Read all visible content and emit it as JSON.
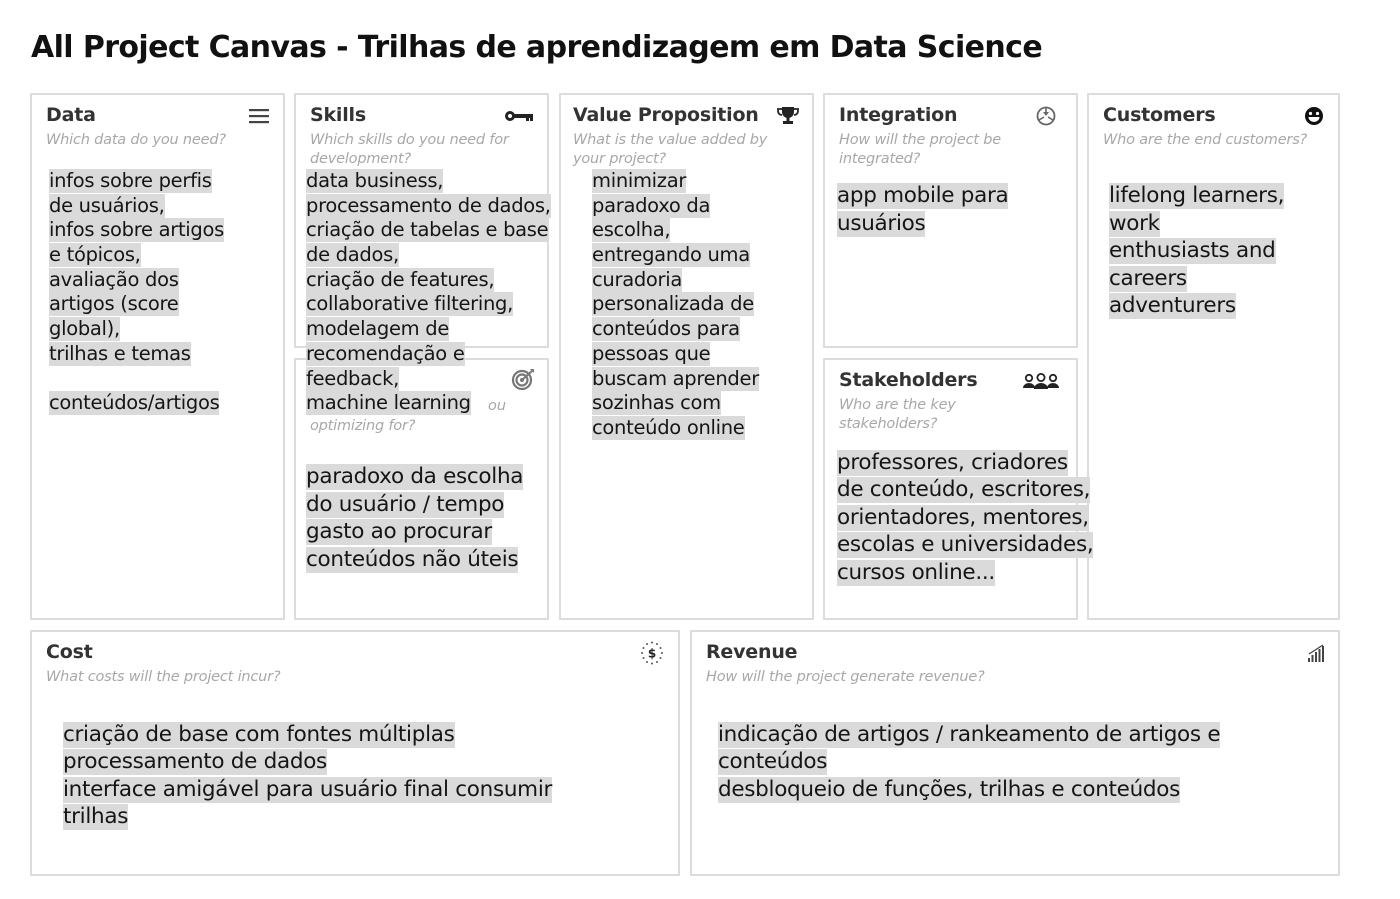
{
  "page": {
    "title": "All Project Canvas - Trilhas de aprendizagem em Data Science"
  },
  "cards": {
    "data": {
      "title": "Data",
      "question": "Which data do you need?",
      "icon": "menu-lines-icon",
      "note_lines": [
        "infos sobre perfis",
        "de usuários,",
        "infos sobre artigos",
        "e tópicos,",
        "avaliação dos",
        "artigos (score",
        "global),",
        "trilhas e temas",
        "",
        "conteúdos/artigos"
      ]
    },
    "skills": {
      "title": "Skills",
      "question": "Which skills do you need for development?",
      "icon": "key-icon",
      "note_lines": [
        "data business,",
        "processamento de dados,",
        "criação de tabelas e base",
        "de dados,",
        "criação de features,",
        "collaborative filtering,",
        "modelagem de",
        "recomendação e",
        "feedback,",
        "machine learning"
      ]
    },
    "outcomes": {
      "question_visible_fragment": "ou",
      "question_tail": "optimizing for?",
      "icon": "target-icon",
      "note_lines": [
        "paradoxo da escolha",
        "do usuário / tempo",
        "gasto ao procurar",
        "conteúdos não úteis"
      ]
    },
    "value_proposition": {
      "title": "Value Proposition",
      "question": "What is the value added by your project?",
      "icon": "trophy-icon",
      "note_lines": [
        "minimizar",
        "paradoxo da",
        "escolha,",
        "entregando uma",
        "curadoria",
        "personalizada de",
        "conteúdos para",
        "pessoas que",
        "buscam aprender",
        "sozinhas com",
        "conteúdo online"
      ]
    },
    "integration": {
      "title": "Integration",
      "question": "How will the project be integrated?",
      "icon": "integration-icon",
      "note_lines": [
        "app mobile para",
        "usuários"
      ]
    },
    "stakeholders": {
      "title": "Stakeholders",
      "question": "Who are the key stakeholders?",
      "icon": "people-group-icon",
      "note_lines": [
        "professores, criadores",
        "de conteúdo, escritores,",
        "orientadores, mentores,",
        "escolas e universidades,",
        "cursos online..."
      ]
    },
    "customers": {
      "title": "Customers",
      "question": "Who are the end customers?",
      "icon": "smiley-icon",
      "note_lines": [
        "lifelong learners,",
        "work",
        "enthusiasts and",
        "careers",
        "adventurers"
      ]
    },
    "cost": {
      "title": "Cost",
      "question": "What costs will the project incur?",
      "icon": "dollar-icon",
      "note_lines": [
        "criação de base com fontes múltiplas",
        "processamento de dados",
        "interface amigável para usuário final consumir",
        "trilhas"
      ]
    },
    "revenue": {
      "title": "Revenue",
      "question": "How will the project generate revenue?",
      "icon": "growth-bars-icon",
      "note_lines": [
        "indicação de artigos / rankeamento de artigos e",
        "conteúdos",
        "desbloqueio de funções, trilhas e conteúdos"
      ]
    }
  },
  "colors": {
    "note_highlight": "#dadada",
    "card_border": "#dcdcdc",
    "question_text": "#a8a8a8"
  }
}
